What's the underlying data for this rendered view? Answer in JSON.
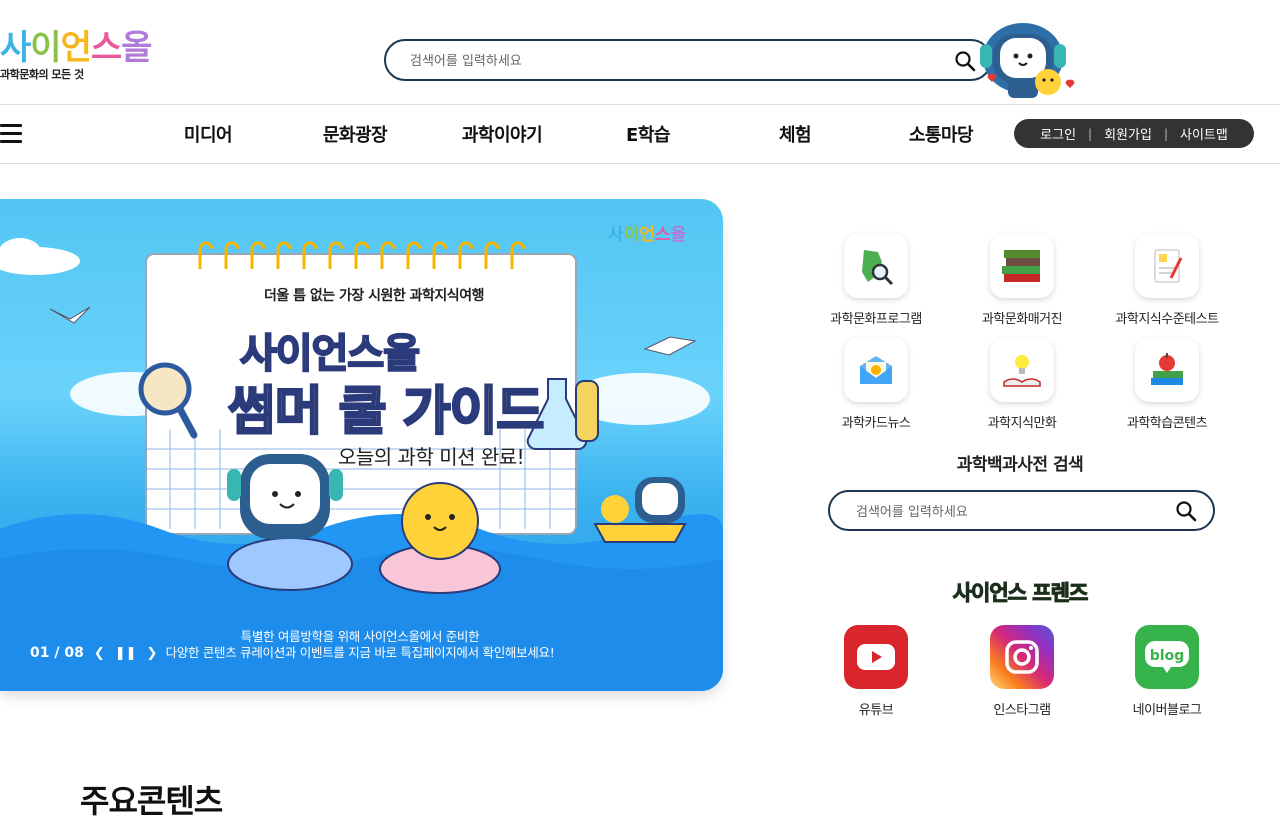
{
  "header": {
    "logo_text": "사이언스올",
    "logo_tagline": "과학문화의 모든 것",
    "search_placeholder": "검색어를 입력하세요"
  },
  "nav": {
    "items": [
      "미디어",
      "문화광장",
      "과학이야기",
      "E학습",
      "체험",
      "소통마당"
    ],
    "util": {
      "login": "로그인",
      "join": "회원가입",
      "sitemap": "사이트맵"
    }
  },
  "banner": {
    "heading": "더울 틈 없는 가장 시원한 과학지식여행",
    "title_line1": "사이언스올",
    "title_line2": "썸머 쿨 가이드",
    "subtitle": "오늘의 과학 미션 완료!",
    "caption_line1": "특별한 여름방학을 위해 사이언스올에서 준비한",
    "caption_line2": "다양한 콘텐츠 큐레이션과 이벤트를 지금 바로 특집페이지에서 확인해보세요!",
    "logo_text": "사이언스올",
    "counter": "01 / 08"
  },
  "quick_menu": [
    {
      "label": "과학문화프로그램",
      "icon": "map-magnifier-icon"
    },
    {
      "label": "과학문화매거진",
      "icon": "books-icon"
    },
    {
      "label": "과학지식수준테스트",
      "icon": "test-paper-icon"
    },
    {
      "label": "과학카드뉴스",
      "icon": "mail-card-icon"
    },
    {
      "label": "과학지식만화",
      "icon": "lightbulb-book-icon"
    },
    {
      "label": "과학학습콘텐츠",
      "icon": "apple-books-icon"
    }
  ],
  "encyclopedia": {
    "title": "과학백과사전 검색",
    "placeholder": "검색어를 입력하세요"
  },
  "friends": {
    "title": "사이언스 프렌즈",
    "items": [
      {
        "label": "유튜브",
        "icon": "youtube-icon",
        "color": "#d8262c"
      },
      {
        "label": "인스타그램",
        "icon": "instagram-icon",
        "color": "#d6249f"
      },
      {
        "label": "네이버블로그",
        "icon": "blog-icon",
        "color": "#36b34a"
      }
    ]
  },
  "main": {
    "heading": "주요콘텐츠"
  }
}
